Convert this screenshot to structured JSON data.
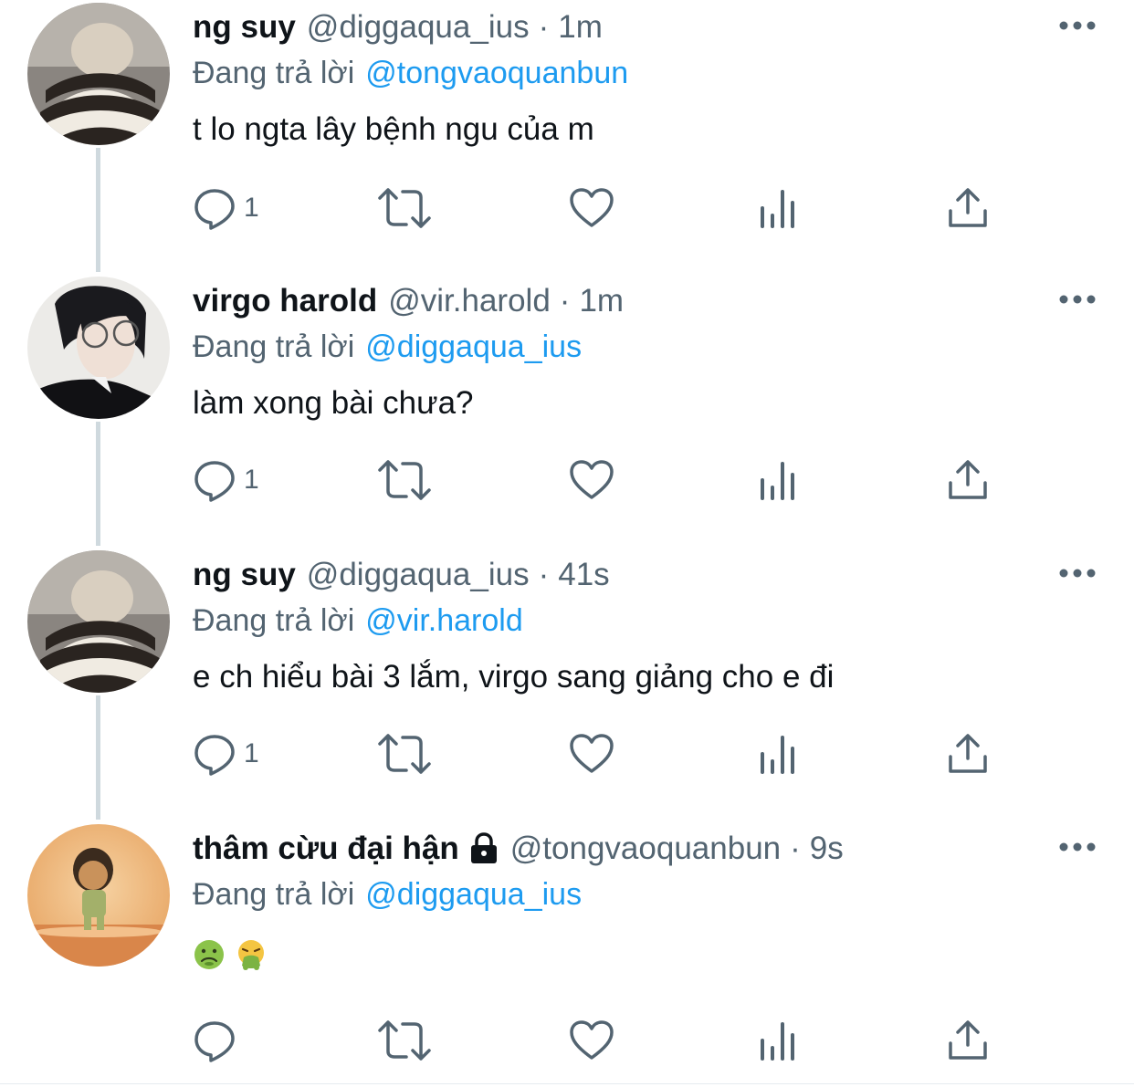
{
  "colors": {
    "text_primary": "#0f1419",
    "text_secondary": "#536471",
    "mention": "#1d9bf0",
    "thread_line": "#cfd9de"
  },
  "tweets": [
    {
      "name": "ng suy",
      "handle": "@diggaqua_ius",
      "separator": "·",
      "time": "1m",
      "replying_label": "Đang trả lời",
      "replying_to": "@tongvaoquanbun",
      "text": "t lo ngta lây bệnh ngu của m",
      "reply_count": "1",
      "avatar": "avatar-striped-sweater",
      "locked": false
    },
    {
      "name": "virgo harold",
      "handle": "@vir.harold",
      "separator": "·",
      "time": "1m",
      "replying_label": "Đang trả lời",
      "replying_to": "@diggaqua_ius",
      "text": "làm xong bài chưa?",
      "reply_count": "1",
      "avatar": "avatar-glasses-portrait",
      "locked": false
    },
    {
      "name": "ng suy",
      "handle": "@diggaqua_ius",
      "separator": "·",
      "time": "41s",
      "replying_label": "Đang trả lời",
      "replying_to": "@vir.harold",
      "text": "e ch hiểu bài 3 lắm, virgo sang giảng cho e đi",
      "reply_count": "1",
      "avatar": "avatar-striped-sweater",
      "locked": false
    },
    {
      "name": "thâm cừu đại hận",
      "handle": "@tongvaoquanbun",
      "separator": "·",
      "time": "9s",
      "replying_label": "Đang trả lời",
      "replying_to": "@diggaqua_ius",
      "emojis": [
        "🤢",
        "🤮"
      ],
      "reply_count": "",
      "avatar": "avatar-cartoon-character",
      "locked": true
    }
  ]
}
